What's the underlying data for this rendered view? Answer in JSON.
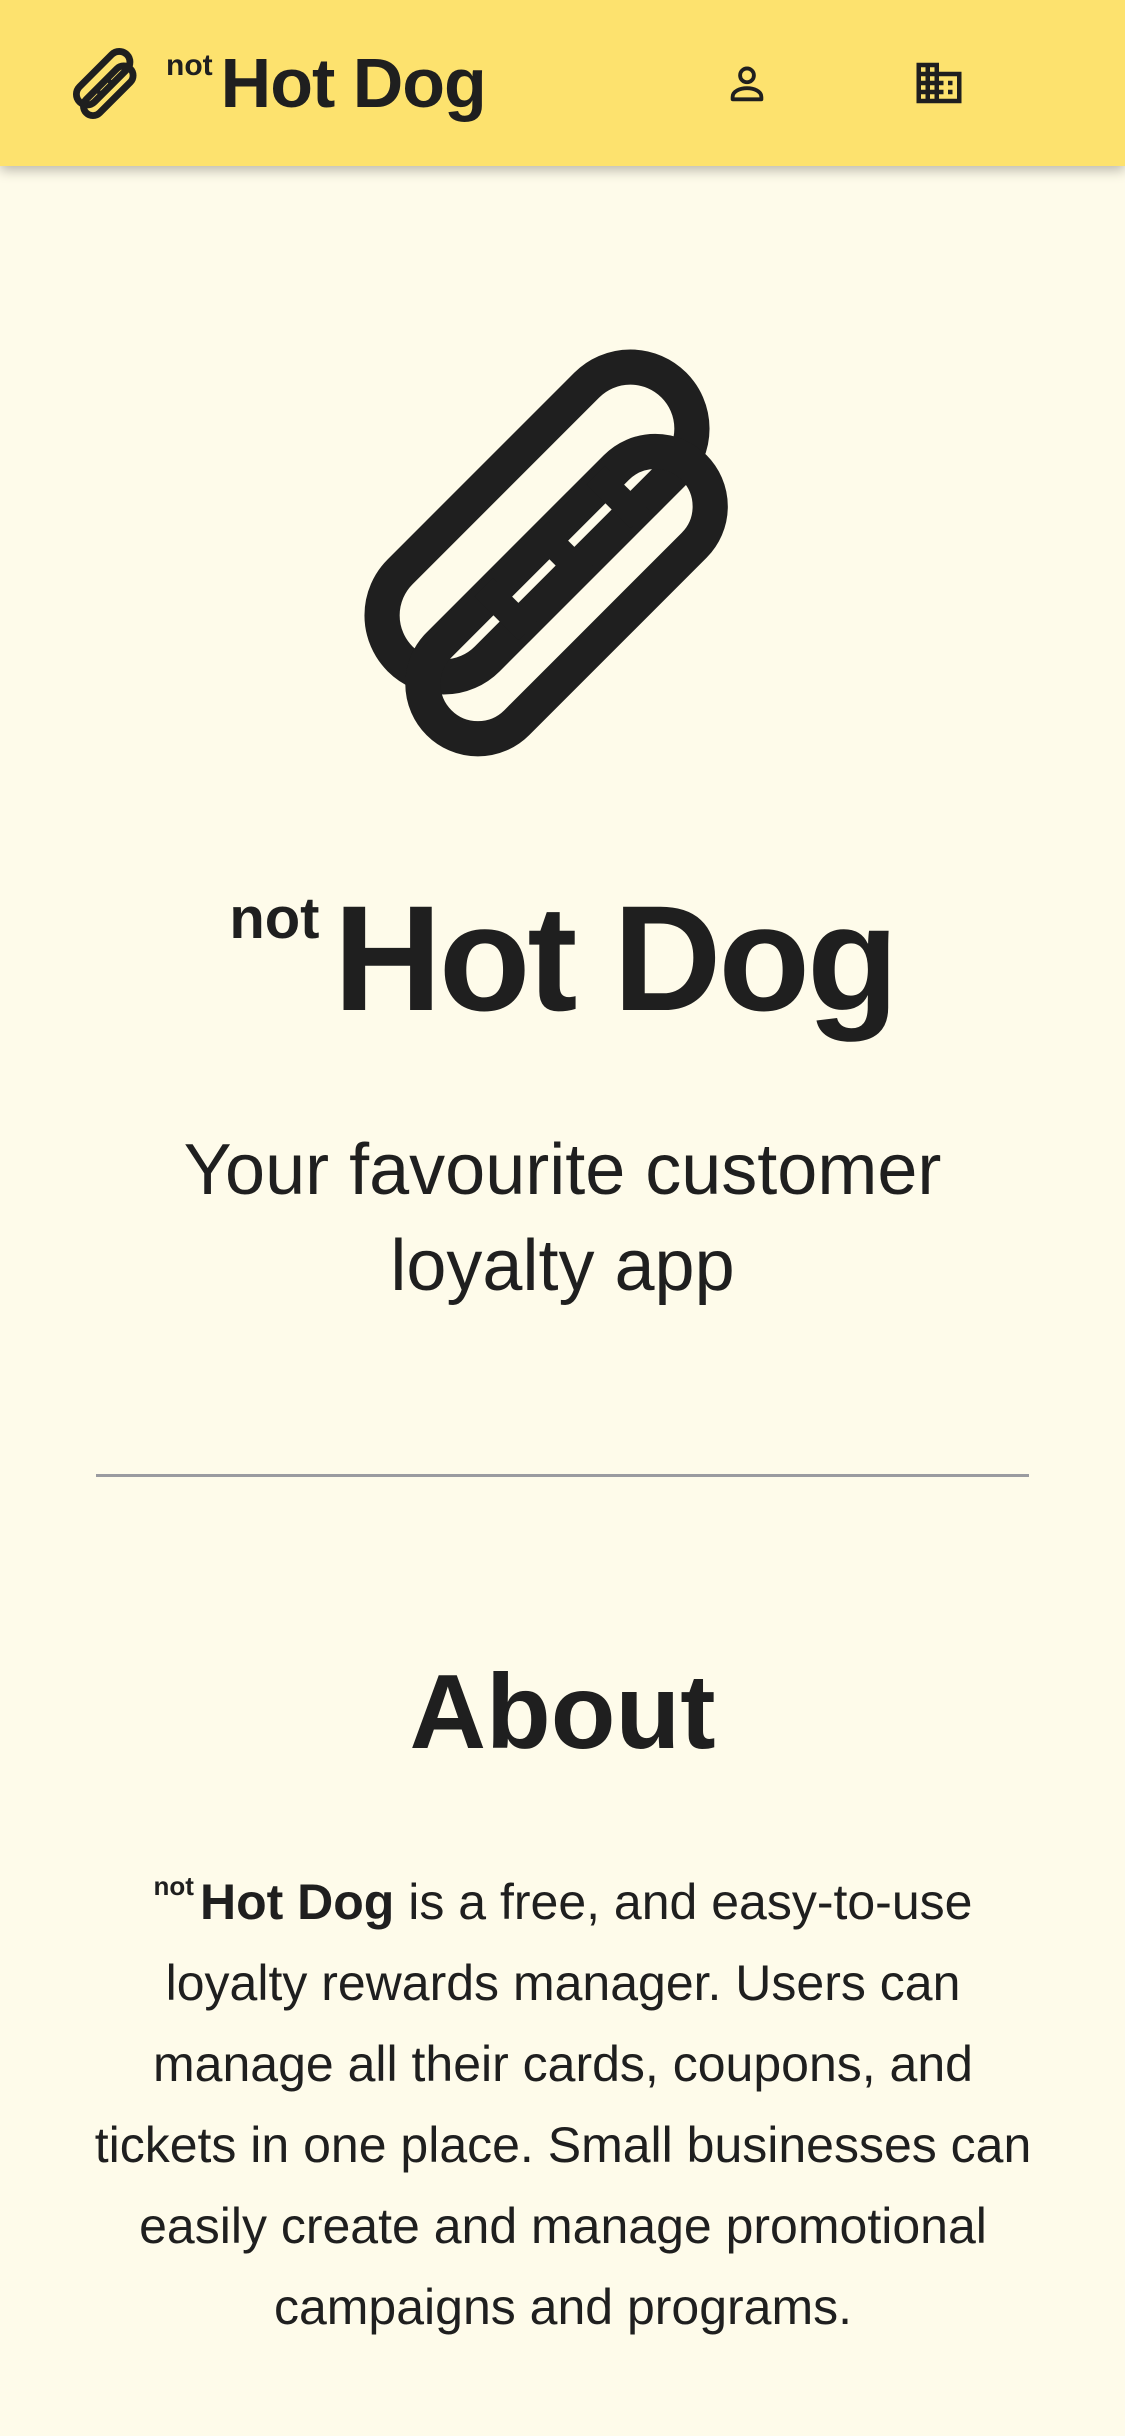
{
  "header": {
    "brand_prefix": "not",
    "brand_name": "Hot Dog",
    "user_icon": "user-icon",
    "business_icon": "building-icon",
    "background_color": "#FDE26E"
  },
  "hero": {
    "logo_icon": "hot-dog-icon",
    "title_prefix": "not",
    "title_name": "Hot Dog",
    "tagline": "Your favourite customer loyalty app"
  },
  "about": {
    "heading": "About",
    "brand_prefix": "not",
    "brand_name": "Hot Dog",
    "body": "is a free, and easy-to-use loyalty rewards manager. Users can manage all their cards, coupons, and tickets in one place. Small businesses can easily create and manage promotional campaigns and programs."
  },
  "colors": {
    "page_background": "#FEFBEA",
    "text": "#1F1F1F",
    "divider": "#9A9BA0"
  }
}
